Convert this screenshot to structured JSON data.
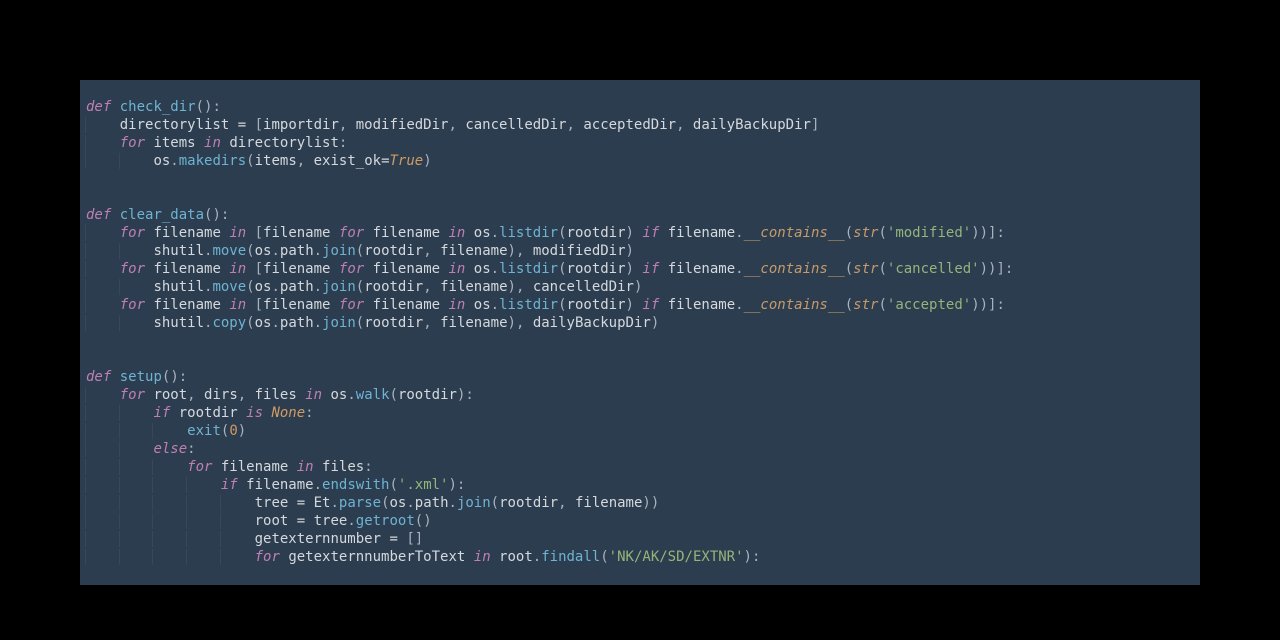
{
  "colors": {
    "background_page": "#000000",
    "background_editor": "#2b3d4f",
    "foreground": "#d5d8dc",
    "keyword": "#c07fb2",
    "function": "#6fb3d2",
    "magic": "#c69a6a",
    "string": "#95b47b",
    "number": "#d19a66",
    "bool": "#d19a66",
    "builtin": "#c69a6a"
  },
  "code_raw": "\ndef check_dir():\n    directorylist = [importdir, modifiedDir, cancelledDir, acceptedDir, dailyBackupDir]\n    for items in directorylist:\n        os.makedirs(items, exist_ok=True)\n\n\ndef clear_data():\n    for filename in [filename for filename in os.listdir(rootdir) if filename.__contains__(str('modified'))]:\n        shutil.move(os.path.join(rootdir, filename), modifiedDir)\n    for filename in [filename for filename in os.listdir(rootdir) if filename.__contains__(str('cancelled'))]:\n        shutil.move(os.path.join(rootdir, filename), cancelledDir)\n    for filename in [filename for filename in os.listdir(rootdir) if filename.__contains__(str('accepted'))]:\n        shutil.copy(os.path.join(rootdir, filename), dailyBackupDir)\n\n\ndef setup():\n    for root, dirs, files in os.walk(rootdir):\n        if rootdir is None:\n            exit(0)\n        else:\n            for filename in files:\n                if filename.endswith('.xml'):\n                    tree = Et.parse(os.path.join(rootdir, filename))\n                    root = tree.getroot()\n                    getexternnumber = []\n                    for getexternnumberToText in root.findall('NK/AK/SD/EXTNR'):",
  "lines": [
    {
      "indent": 0,
      "tokens": []
    },
    {
      "indent": 0,
      "tokens": [
        [
          "kw",
          "def"
        ],
        [
          "pn",
          " "
        ],
        [
          "fn",
          "check_dir"
        ],
        [
          "pn",
          "():"
        ]
      ]
    },
    {
      "indent": 4,
      "tokens": [
        [
          "id",
          "directorylist "
        ],
        [
          "op",
          "= "
        ],
        [
          "pn",
          "["
        ],
        [
          "id",
          "importdir"
        ],
        [
          "pn",
          ", "
        ],
        [
          "id",
          "modifiedDir"
        ],
        [
          "pn",
          ", "
        ],
        [
          "id",
          "cancelledDir"
        ],
        [
          "pn",
          ", "
        ],
        [
          "id",
          "acceptedDir"
        ],
        [
          "pn",
          ", "
        ],
        [
          "id",
          "dailyBackupDir"
        ],
        [
          "pn",
          "]"
        ]
      ]
    },
    {
      "indent": 4,
      "tokens": [
        [
          "kw",
          "for"
        ],
        [
          "id",
          " items "
        ],
        [
          "kw",
          "in"
        ],
        [
          "id",
          " directorylist"
        ],
        [
          "pn",
          ":"
        ]
      ]
    },
    {
      "indent": 8,
      "tokens": [
        [
          "id",
          "os"
        ],
        [
          "pn",
          "."
        ],
        [
          "fn",
          "makedirs"
        ],
        [
          "pn",
          "("
        ],
        [
          "id",
          "items"
        ],
        [
          "pn",
          ", "
        ],
        [
          "id",
          "exist_ok"
        ],
        [
          "op",
          "="
        ],
        [
          "bol",
          "True"
        ],
        [
          "pn",
          ")"
        ]
      ]
    },
    {
      "indent": 0,
      "tokens": []
    },
    {
      "indent": 0,
      "tokens": []
    },
    {
      "indent": 0,
      "tokens": [
        [
          "kw",
          "def"
        ],
        [
          "pn",
          " "
        ],
        [
          "fn",
          "clear_data"
        ],
        [
          "pn",
          "():"
        ]
      ]
    },
    {
      "indent": 4,
      "tokens": [
        [
          "kw",
          "for"
        ],
        [
          "id",
          " filename "
        ],
        [
          "kw",
          "in"
        ],
        [
          "pn",
          " ["
        ],
        [
          "id",
          "filename "
        ],
        [
          "kw",
          "for"
        ],
        [
          "id",
          " filename "
        ],
        [
          "kw",
          "in"
        ],
        [
          "id",
          " os"
        ],
        [
          "pn",
          "."
        ],
        [
          "fn",
          "listdir"
        ],
        [
          "pn",
          "("
        ],
        [
          "id",
          "rootdir"
        ],
        [
          "pn",
          ") "
        ],
        [
          "kw",
          "if"
        ],
        [
          "id",
          " filename"
        ],
        [
          "pn",
          "."
        ],
        [
          "mag",
          "__contains__"
        ],
        [
          "pn",
          "("
        ],
        [
          "bi",
          "str"
        ],
        [
          "pn",
          "("
        ],
        [
          "str",
          "'modified'"
        ],
        [
          "pn",
          "))]:"
        ]
      ]
    },
    {
      "indent": 8,
      "tokens": [
        [
          "id",
          "shutil"
        ],
        [
          "pn",
          "."
        ],
        [
          "fn",
          "move"
        ],
        [
          "pn",
          "("
        ],
        [
          "id",
          "os"
        ],
        [
          "pn",
          "."
        ],
        [
          "id",
          "path"
        ],
        [
          "pn",
          "."
        ],
        [
          "fn",
          "join"
        ],
        [
          "pn",
          "("
        ],
        [
          "id",
          "rootdir"
        ],
        [
          "pn",
          ", "
        ],
        [
          "id",
          "filename"
        ],
        [
          "pn",
          "), "
        ],
        [
          "id",
          "modifiedDir"
        ],
        [
          "pn",
          ")"
        ]
      ]
    },
    {
      "indent": 4,
      "tokens": [
        [
          "kw",
          "for"
        ],
        [
          "id",
          " filename "
        ],
        [
          "kw",
          "in"
        ],
        [
          "pn",
          " ["
        ],
        [
          "id",
          "filename "
        ],
        [
          "kw",
          "for"
        ],
        [
          "id",
          " filename "
        ],
        [
          "kw",
          "in"
        ],
        [
          "id",
          " os"
        ],
        [
          "pn",
          "."
        ],
        [
          "fn",
          "listdir"
        ],
        [
          "pn",
          "("
        ],
        [
          "id",
          "rootdir"
        ],
        [
          "pn",
          ") "
        ],
        [
          "kw",
          "if"
        ],
        [
          "id",
          " filename"
        ],
        [
          "pn",
          "."
        ],
        [
          "mag",
          "__contains__"
        ],
        [
          "pn",
          "("
        ],
        [
          "bi",
          "str"
        ],
        [
          "pn",
          "("
        ],
        [
          "str",
          "'cancelled'"
        ],
        [
          "pn",
          "))]:"
        ]
      ]
    },
    {
      "indent": 8,
      "tokens": [
        [
          "id",
          "shutil"
        ],
        [
          "pn",
          "."
        ],
        [
          "fn",
          "move"
        ],
        [
          "pn",
          "("
        ],
        [
          "id",
          "os"
        ],
        [
          "pn",
          "."
        ],
        [
          "id",
          "path"
        ],
        [
          "pn",
          "."
        ],
        [
          "fn",
          "join"
        ],
        [
          "pn",
          "("
        ],
        [
          "id",
          "rootdir"
        ],
        [
          "pn",
          ", "
        ],
        [
          "id",
          "filename"
        ],
        [
          "pn",
          "), "
        ],
        [
          "id",
          "cancelledDir"
        ],
        [
          "pn",
          ")"
        ]
      ]
    },
    {
      "indent": 4,
      "tokens": [
        [
          "kw",
          "for"
        ],
        [
          "id",
          " filename "
        ],
        [
          "kw",
          "in"
        ],
        [
          "pn",
          " ["
        ],
        [
          "id",
          "filename "
        ],
        [
          "kw",
          "for"
        ],
        [
          "id",
          " filename "
        ],
        [
          "kw",
          "in"
        ],
        [
          "id",
          " os"
        ],
        [
          "pn",
          "."
        ],
        [
          "fn",
          "listdir"
        ],
        [
          "pn",
          "("
        ],
        [
          "id",
          "rootdir"
        ],
        [
          "pn",
          ") "
        ],
        [
          "kw",
          "if"
        ],
        [
          "id",
          " filename"
        ],
        [
          "pn",
          "."
        ],
        [
          "mag",
          "__contains__"
        ],
        [
          "pn",
          "("
        ],
        [
          "bi",
          "str"
        ],
        [
          "pn",
          "("
        ],
        [
          "str",
          "'accepted'"
        ],
        [
          "pn",
          "))]:"
        ]
      ]
    },
    {
      "indent": 8,
      "tokens": [
        [
          "id",
          "shutil"
        ],
        [
          "pn",
          "."
        ],
        [
          "fn",
          "copy"
        ],
        [
          "pn",
          "("
        ],
        [
          "id",
          "os"
        ],
        [
          "pn",
          "."
        ],
        [
          "id",
          "path"
        ],
        [
          "pn",
          "."
        ],
        [
          "fn",
          "join"
        ],
        [
          "pn",
          "("
        ],
        [
          "id",
          "rootdir"
        ],
        [
          "pn",
          ", "
        ],
        [
          "id",
          "filename"
        ],
        [
          "pn",
          "), "
        ],
        [
          "id",
          "dailyBackupDir"
        ],
        [
          "pn",
          ")"
        ]
      ]
    },
    {
      "indent": 0,
      "tokens": []
    },
    {
      "indent": 0,
      "tokens": []
    },
    {
      "indent": 0,
      "tokens": [
        [
          "kw",
          "def"
        ],
        [
          "pn",
          " "
        ],
        [
          "fn",
          "setup"
        ],
        [
          "pn",
          "():"
        ]
      ]
    },
    {
      "indent": 4,
      "tokens": [
        [
          "kw",
          "for"
        ],
        [
          "id",
          " root"
        ],
        [
          "pn",
          ", "
        ],
        [
          "id",
          "dirs"
        ],
        [
          "pn",
          ", "
        ],
        [
          "id",
          "files "
        ],
        [
          "kw",
          "in"
        ],
        [
          "id",
          " os"
        ],
        [
          "pn",
          "."
        ],
        [
          "fn",
          "walk"
        ],
        [
          "pn",
          "("
        ],
        [
          "id",
          "rootdir"
        ],
        [
          "pn",
          "):"
        ]
      ]
    },
    {
      "indent": 8,
      "tokens": [
        [
          "kw",
          "if"
        ],
        [
          "id",
          " rootdir "
        ],
        [
          "kw",
          "is"
        ],
        [
          "pn",
          " "
        ],
        [
          "bol",
          "None"
        ],
        [
          "pn",
          ":"
        ]
      ]
    },
    {
      "indent": 12,
      "tokens": [
        [
          "fn",
          "exit"
        ],
        [
          "pn",
          "("
        ],
        [
          "num",
          "0"
        ],
        [
          "pn",
          ")"
        ]
      ]
    },
    {
      "indent": 8,
      "tokens": [
        [
          "kw",
          "else"
        ],
        [
          "pn",
          ":"
        ]
      ]
    },
    {
      "indent": 12,
      "tokens": [
        [
          "kw",
          "for"
        ],
        [
          "id",
          " filename "
        ],
        [
          "kw",
          "in"
        ],
        [
          "id",
          " files"
        ],
        [
          "pn",
          ":"
        ]
      ]
    },
    {
      "indent": 16,
      "tokens": [
        [
          "kw",
          "if"
        ],
        [
          "id",
          " filename"
        ],
        [
          "pn",
          "."
        ],
        [
          "fn",
          "endswith"
        ],
        [
          "pn",
          "("
        ],
        [
          "str",
          "'.xml'"
        ],
        [
          "pn",
          "):"
        ]
      ]
    },
    {
      "indent": 20,
      "tokens": [
        [
          "id",
          "tree "
        ],
        [
          "op",
          "= "
        ],
        [
          "id",
          "Et"
        ],
        [
          "pn",
          "."
        ],
        [
          "fn",
          "parse"
        ],
        [
          "pn",
          "("
        ],
        [
          "id",
          "os"
        ],
        [
          "pn",
          "."
        ],
        [
          "id",
          "path"
        ],
        [
          "pn",
          "."
        ],
        [
          "fn",
          "join"
        ],
        [
          "pn",
          "("
        ],
        [
          "id",
          "rootdir"
        ],
        [
          "pn",
          ", "
        ],
        [
          "id",
          "filename"
        ],
        [
          "pn",
          "))"
        ]
      ]
    },
    {
      "indent": 20,
      "tokens": [
        [
          "id",
          "root "
        ],
        [
          "op",
          "= "
        ],
        [
          "id",
          "tree"
        ],
        [
          "pn",
          "."
        ],
        [
          "fn",
          "getroot"
        ],
        [
          "pn",
          "()"
        ]
      ]
    },
    {
      "indent": 20,
      "tokens": [
        [
          "id",
          "getexternnumber "
        ],
        [
          "op",
          "= "
        ],
        [
          "pn",
          "[]"
        ]
      ]
    },
    {
      "indent": 20,
      "tokens": [
        [
          "kw",
          "for"
        ],
        [
          "id",
          " getexternnumberToText "
        ],
        [
          "kw",
          "in"
        ],
        [
          "id",
          " root"
        ],
        [
          "pn",
          "."
        ],
        [
          "fn",
          "findall"
        ],
        [
          "pn",
          "("
        ],
        [
          "str",
          "'NK/AK/SD/EXTNR'"
        ],
        [
          "pn",
          "):"
        ]
      ]
    }
  ]
}
